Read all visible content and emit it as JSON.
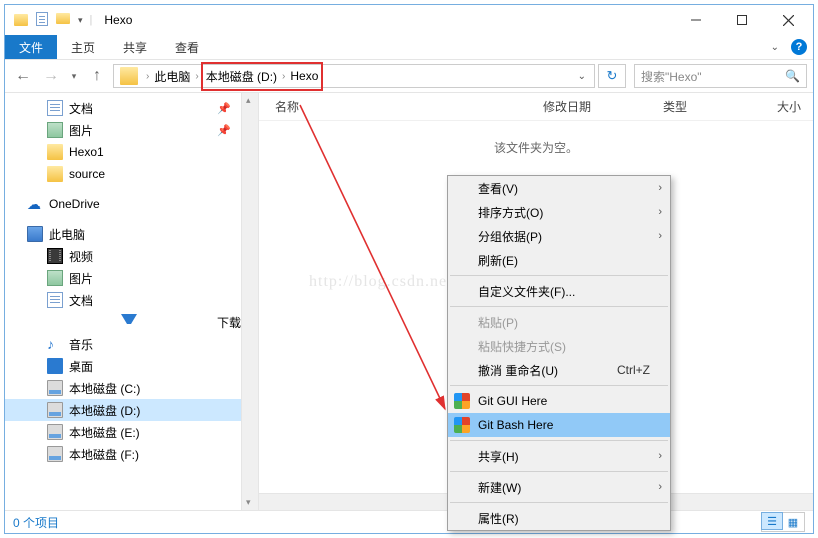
{
  "titlebar": {
    "title": "Hexo"
  },
  "ribbon": {
    "file": "文件",
    "tabs": [
      "主页",
      "共享",
      "查看"
    ]
  },
  "address": {
    "seg1": "此电脑",
    "seg2": "本地磁盘 (D:)",
    "seg3": "Hexo"
  },
  "search": {
    "placeholder": "搜索\"Hexo\""
  },
  "columns": {
    "name": "名称",
    "date": "修改日期",
    "type": "类型",
    "size": "大小"
  },
  "empty": "该文件夹为空。",
  "watermark": "http://blog.csdn.net/AinUser",
  "nav": {
    "quick": [
      {
        "label": "文档",
        "icon": "i-doc",
        "pin": true
      },
      {
        "label": "图片",
        "icon": "i-img",
        "pin": true
      },
      {
        "label": "Hexo1",
        "icon": "i-folder",
        "pin": false
      },
      {
        "label": "source",
        "icon": "i-folder",
        "pin": false
      }
    ],
    "onedrive": "OneDrive",
    "thispc": "此电脑",
    "thispc_children": [
      {
        "label": "视频",
        "icon": "i-vid"
      },
      {
        "label": "图片",
        "icon": "i-img"
      },
      {
        "label": "文档",
        "icon": "i-doc"
      },
      {
        "label": "下载",
        "icon": "i-dl"
      },
      {
        "label": "音乐",
        "icon": "i-music",
        "glyph": "♪"
      },
      {
        "label": "桌面",
        "icon": "i-desk"
      },
      {
        "label": "本地磁盘 (C:)",
        "icon": "i-disk"
      },
      {
        "label": "本地磁盘 (D:)",
        "icon": "i-disk",
        "sel": true
      },
      {
        "label": "本地磁盘 (E:)",
        "icon": "i-disk"
      },
      {
        "label": "本地磁盘 (F:)",
        "icon": "i-disk"
      }
    ]
  },
  "ctx": {
    "view": "查看(V)",
    "sort": "排序方式(O)",
    "group": "分组依据(P)",
    "refresh": "刷新(E)",
    "custom": "自定义文件夹(F)...",
    "paste": "粘贴(P)",
    "paste_shortcut": "粘贴快捷方式(S)",
    "undo": "撤消 重命名(U)",
    "undo_sc": "Ctrl+Z",
    "gitgui": "Git GUI Here",
    "gitbash": "Git Bash Here",
    "share": "共享(H)",
    "new": "新建(W)",
    "props": "属性(R)"
  },
  "status": {
    "items": "0 个项目"
  }
}
